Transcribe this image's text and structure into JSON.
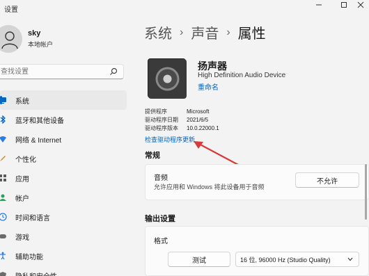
{
  "window": {
    "title": "设置",
    "min_icon": "minimize-icon",
    "max_icon": "maximize-icon",
    "close_icon": "close-icon"
  },
  "profile": {
    "name": "sky",
    "account_type": "本地帐户"
  },
  "search": {
    "placeholder": "查找设置"
  },
  "sidebar": {
    "items": [
      {
        "label": "系统",
        "icon": "system-icon",
        "active": true,
        "color": "#0067c0"
      },
      {
        "label": "蓝牙和其他设备",
        "icon": "bluetooth-icon",
        "color": "#0067c0"
      },
      {
        "label": "网络 & Internet",
        "icon": "network-icon",
        "color": "#2a7de1"
      },
      {
        "label": "个性化",
        "icon": "personalization-icon",
        "color": "#c9862a"
      },
      {
        "label": "应用",
        "icon": "apps-icon",
        "color": "#5a5a5a"
      },
      {
        "label": "帐户",
        "icon": "accounts-icon",
        "color": "#2e9e5b"
      },
      {
        "label": "时间和语言",
        "icon": "time-language-icon",
        "color": "#2a7de1"
      },
      {
        "label": "游戏",
        "icon": "gaming-icon",
        "color": "#6b6b6b"
      },
      {
        "label": "辅助功能",
        "icon": "accessibility-icon",
        "color": "#2a7de1"
      },
      {
        "label": "隐私和安全性",
        "icon": "privacy-icon",
        "color": "#6b6b6b"
      }
    ]
  },
  "breadcrumb": {
    "level1": "系统",
    "level2": "声音",
    "current": "属性",
    "separator": "›"
  },
  "device": {
    "name": "扬声器",
    "description": "High Definition Audio Device",
    "rename_label": "重命名",
    "image_icon": "speaker-icon"
  },
  "properties": [
    {
      "label": "提供程序",
      "value": "Microsoft"
    },
    {
      "label": "驱动程序日期",
      "value": "2021/6/5"
    },
    {
      "label": "驱动程序版本",
      "value": "10.0.22000.1"
    }
  ],
  "update_driver_link": "检查驱动程序更新",
  "general": {
    "section_title": "常规",
    "audio_title": "音频",
    "audio_desc": "允许应用和 Windows 将此设备用于音频",
    "disallow_button": "不允许"
  },
  "output": {
    "section_title": "输出设置",
    "format_label": "格式",
    "test_button": "测试",
    "format_value": "16 位, 96000 Hz (Studio Quality)"
  },
  "colors": {
    "accent": "#0067c0",
    "annotation_arrow": "#d63a3a"
  }
}
